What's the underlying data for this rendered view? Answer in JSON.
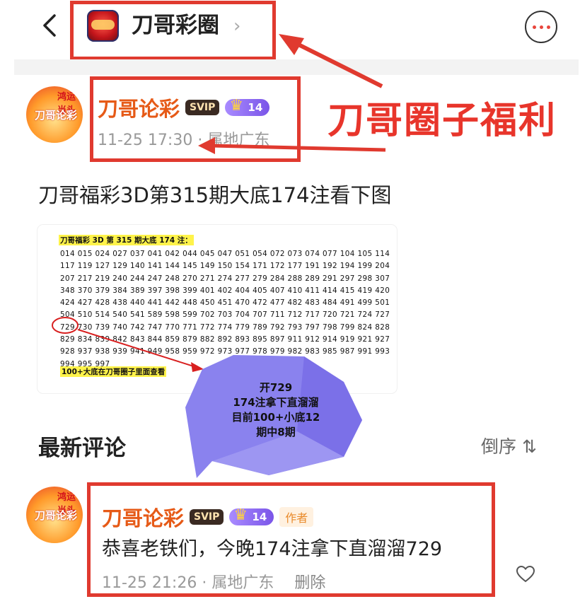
{
  "header": {
    "title": "刀哥彩圈",
    "back_icon": "chevron-left-icon",
    "more_icon": "more-icon"
  },
  "post": {
    "author": "刀哥论彩",
    "badge_vip": "SVIP",
    "level": "14",
    "time": "11-25 17:30",
    "location": "属地广东",
    "title": "刀哥福彩3D第315期大底174注看下图",
    "avatar_text_top": "鸿运当头",
    "avatar_text_mid": "刀哥论彩",
    "image": {
      "heading": "刀哥福彩 3D 第 315 期大底 174 注：",
      "lines": [
        "014 015 024 027 037 041 042 044 045 047 051 054 072 073 074 077 104 105 114",
        "117 119 127 129 140 141 144 145 149 150 154 171 172 177 191 192 194 199 204",
        "207 217 219 240 244 247 248 270 271 274 277 279 284 288 289 291 297 298 307",
        "348 370 379 384 389 397 398 399 401 402 404 405 407 410 411 414 415 419 420",
        "424 427 428 438 440 441 442 448 450 451 470 472 477 482 483 484 491 499 501",
        "504 510 514 540 541 589 598 599 702 703 704 707 711 712 717 720 721 724 727",
        "729 730 739 740 742 747 770 771 772 774 779 789 792 793 797 798 799 824 828",
        "829 834 839 842 843 844 859 879 882 892 893 895 897 911 912 914 919 921 927",
        "928 937 938 939 941 949 958 959 972 973 977 978 979 982 983 985 987 991 993",
        "994 995 997"
      ],
      "footer": "100+大底在刀哥圈子里面查看"
    }
  },
  "annotations": {
    "big_label": "刀哥圈子福利",
    "bubble_lines": [
      "开729",
      "174注拿下直溜溜",
      "目前100+小底12",
      "期中8期"
    ]
  },
  "comments_section": {
    "title": "最新评论",
    "sort_label": "倒序 ⇅"
  },
  "comment": {
    "author": "刀哥论彩",
    "badge_vip": "SVIP",
    "level": "14",
    "author_tag": "作者",
    "text": "恭喜老铁们，今晚174注拿下直溜溜729",
    "time": "11-25 21:26",
    "location": "属地广东",
    "delete_label": "删除",
    "like_icon": "heart-icon"
  },
  "colors": {
    "annotation_red": "#e03a2f",
    "author_orange": "#e65a17",
    "bubble_purple": "#7b70e8"
  }
}
